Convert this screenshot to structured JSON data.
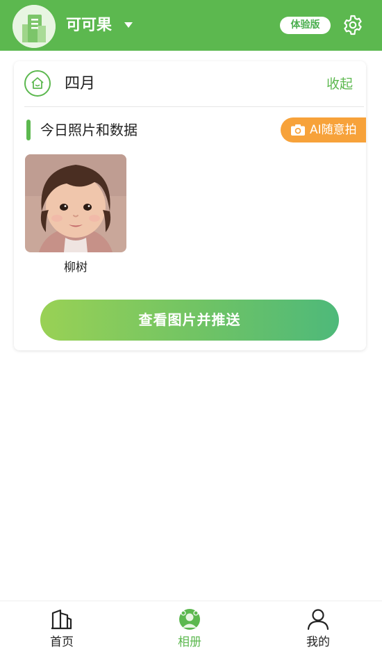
{
  "header": {
    "school_name": "可可果",
    "trial_badge": "体验版"
  },
  "card": {
    "month_title": "四月",
    "collapse_label": "收起",
    "section_title": "今日照片和数据",
    "ai_capture_label": "AI随意拍",
    "photos": [
      {
        "caption": "柳树"
      }
    ],
    "push_button_label": "查看图片并推送"
  },
  "bottom_nav": {
    "items": [
      {
        "label": "首页",
        "icon": "building-icon",
        "active": false
      },
      {
        "label": "相册",
        "icon": "album-icon",
        "active": true
      },
      {
        "label": "我的",
        "icon": "person-icon",
        "active": false
      }
    ]
  },
  "colors": {
    "brand_green": "#5cb84f",
    "accent_orange": "#f7a23a",
    "button_gradient_start": "#99d155",
    "button_gradient_end": "#4eb97a"
  }
}
